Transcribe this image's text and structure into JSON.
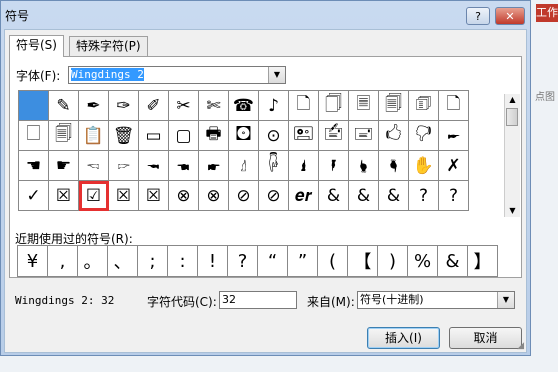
{
  "window": {
    "title": "符号",
    "help_label": "?",
    "close_label": "✕"
  },
  "background": {
    "excel_tab": "工作",
    "side_text": "点图"
  },
  "tabs": [
    {
      "label": "符号(S)"
    },
    {
      "label": "特殊字符(P)"
    }
  ],
  "font": {
    "label": "字体(F):",
    "value": "Wingdings 2"
  },
  "symbols": [
    [
      "",
      "✎",
      "✒",
      "✑",
      "✐",
      "✂",
      "✄",
      "☎",
      "♪",
      "🗋",
      "🗍",
      "🗏",
      "🗐",
      "🗊",
      "🗋"
    ],
    [
      "🗌",
      "🗐",
      "📋",
      "🗑",
      "▭",
      "▢",
      "🖶",
      "🖸",
      "⊙",
      "🖭",
      "🖆",
      "🖃",
      "🖒",
      "🖓",
      "🖛"
    ],
    [
      "☚",
      "☛",
      "🖘",
      "🖙",
      "🖚",
      "🖜",
      "🖝",
      "🖞",
      "🖟",
      "🖠",
      "🖡",
      "🖢",
      "🖣",
      "✋",
      "✗"
    ],
    [
      "✓",
      "☒",
      "☑",
      "☒",
      "☒",
      "⊗",
      "⊗",
      "⊘",
      "⊘",
      "𝒆𝒓",
      "&",
      "&",
      "&",
      "?",
      "?"
    ]
  ],
  "recent": {
    "label": "近期使用过的符号(R):",
    "items": [
      "¥",
      ",",
      "。",
      "、",
      ";",
      ":",
      "!",
      "?",
      "“",
      "”",
      "(",
      "【",
      ")",
      "%",
      "&",
      "】"
    ]
  },
  "footer": {
    "font_code_text": "Wingdings 2: 32",
    "char_code_label": "字符代码(C):",
    "char_code_value": "32",
    "from_label": "来自(M):",
    "from_value": "符号(十进制)"
  },
  "buttons": {
    "insert": "插入(I)",
    "cancel": "取消"
  }
}
